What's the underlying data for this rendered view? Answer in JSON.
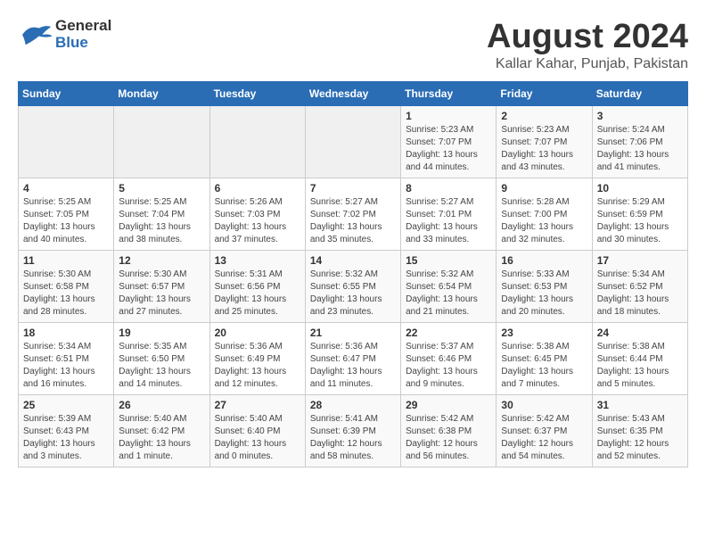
{
  "header": {
    "logo_general": "General",
    "logo_blue": "Blue",
    "title": "August 2024",
    "subtitle": "Kallar Kahar, Punjab, Pakistan"
  },
  "calendar": {
    "weekdays": [
      "Sunday",
      "Monday",
      "Tuesday",
      "Wednesday",
      "Thursday",
      "Friday",
      "Saturday"
    ],
    "weeks": [
      [
        {
          "day": "",
          "info": ""
        },
        {
          "day": "",
          "info": ""
        },
        {
          "day": "",
          "info": ""
        },
        {
          "day": "",
          "info": ""
        },
        {
          "day": "1",
          "info": "Sunrise: 5:23 AM\nSunset: 7:07 PM\nDaylight: 13 hours\nand 44 minutes."
        },
        {
          "day": "2",
          "info": "Sunrise: 5:23 AM\nSunset: 7:07 PM\nDaylight: 13 hours\nand 43 minutes."
        },
        {
          "day": "3",
          "info": "Sunrise: 5:24 AM\nSunset: 7:06 PM\nDaylight: 13 hours\nand 41 minutes."
        }
      ],
      [
        {
          "day": "4",
          "info": "Sunrise: 5:25 AM\nSunset: 7:05 PM\nDaylight: 13 hours\nand 40 minutes."
        },
        {
          "day": "5",
          "info": "Sunrise: 5:25 AM\nSunset: 7:04 PM\nDaylight: 13 hours\nand 38 minutes."
        },
        {
          "day": "6",
          "info": "Sunrise: 5:26 AM\nSunset: 7:03 PM\nDaylight: 13 hours\nand 37 minutes."
        },
        {
          "day": "7",
          "info": "Sunrise: 5:27 AM\nSunset: 7:02 PM\nDaylight: 13 hours\nand 35 minutes."
        },
        {
          "day": "8",
          "info": "Sunrise: 5:27 AM\nSunset: 7:01 PM\nDaylight: 13 hours\nand 33 minutes."
        },
        {
          "day": "9",
          "info": "Sunrise: 5:28 AM\nSunset: 7:00 PM\nDaylight: 13 hours\nand 32 minutes."
        },
        {
          "day": "10",
          "info": "Sunrise: 5:29 AM\nSunset: 6:59 PM\nDaylight: 13 hours\nand 30 minutes."
        }
      ],
      [
        {
          "day": "11",
          "info": "Sunrise: 5:30 AM\nSunset: 6:58 PM\nDaylight: 13 hours\nand 28 minutes."
        },
        {
          "day": "12",
          "info": "Sunrise: 5:30 AM\nSunset: 6:57 PM\nDaylight: 13 hours\nand 27 minutes."
        },
        {
          "day": "13",
          "info": "Sunrise: 5:31 AM\nSunset: 6:56 PM\nDaylight: 13 hours\nand 25 minutes."
        },
        {
          "day": "14",
          "info": "Sunrise: 5:32 AM\nSunset: 6:55 PM\nDaylight: 13 hours\nand 23 minutes."
        },
        {
          "day": "15",
          "info": "Sunrise: 5:32 AM\nSunset: 6:54 PM\nDaylight: 13 hours\nand 21 minutes."
        },
        {
          "day": "16",
          "info": "Sunrise: 5:33 AM\nSunset: 6:53 PM\nDaylight: 13 hours\nand 20 minutes."
        },
        {
          "day": "17",
          "info": "Sunrise: 5:34 AM\nSunset: 6:52 PM\nDaylight: 13 hours\nand 18 minutes."
        }
      ],
      [
        {
          "day": "18",
          "info": "Sunrise: 5:34 AM\nSunset: 6:51 PM\nDaylight: 13 hours\nand 16 minutes."
        },
        {
          "day": "19",
          "info": "Sunrise: 5:35 AM\nSunset: 6:50 PM\nDaylight: 13 hours\nand 14 minutes."
        },
        {
          "day": "20",
          "info": "Sunrise: 5:36 AM\nSunset: 6:49 PM\nDaylight: 13 hours\nand 12 minutes."
        },
        {
          "day": "21",
          "info": "Sunrise: 5:36 AM\nSunset: 6:47 PM\nDaylight: 13 hours\nand 11 minutes."
        },
        {
          "day": "22",
          "info": "Sunrise: 5:37 AM\nSunset: 6:46 PM\nDaylight: 13 hours\nand 9 minutes."
        },
        {
          "day": "23",
          "info": "Sunrise: 5:38 AM\nSunset: 6:45 PM\nDaylight: 13 hours\nand 7 minutes."
        },
        {
          "day": "24",
          "info": "Sunrise: 5:38 AM\nSunset: 6:44 PM\nDaylight: 13 hours\nand 5 minutes."
        }
      ],
      [
        {
          "day": "25",
          "info": "Sunrise: 5:39 AM\nSunset: 6:43 PM\nDaylight: 13 hours\nand 3 minutes."
        },
        {
          "day": "26",
          "info": "Sunrise: 5:40 AM\nSunset: 6:42 PM\nDaylight: 13 hours\nand 1 minute."
        },
        {
          "day": "27",
          "info": "Sunrise: 5:40 AM\nSunset: 6:40 PM\nDaylight: 13 hours\nand 0 minutes."
        },
        {
          "day": "28",
          "info": "Sunrise: 5:41 AM\nSunset: 6:39 PM\nDaylight: 12 hours\nand 58 minutes."
        },
        {
          "day": "29",
          "info": "Sunrise: 5:42 AM\nSunset: 6:38 PM\nDaylight: 12 hours\nand 56 minutes."
        },
        {
          "day": "30",
          "info": "Sunrise: 5:42 AM\nSunset: 6:37 PM\nDaylight: 12 hours\nand 54 minutes."
        },
        {
          "day": "31",
          "info": "Sunrise: 5:43 AM\nSunset: 6:35 PM\nDaylight: 12 hours\nand 52 minutes."
        }
      ]
    ]
  }
}
